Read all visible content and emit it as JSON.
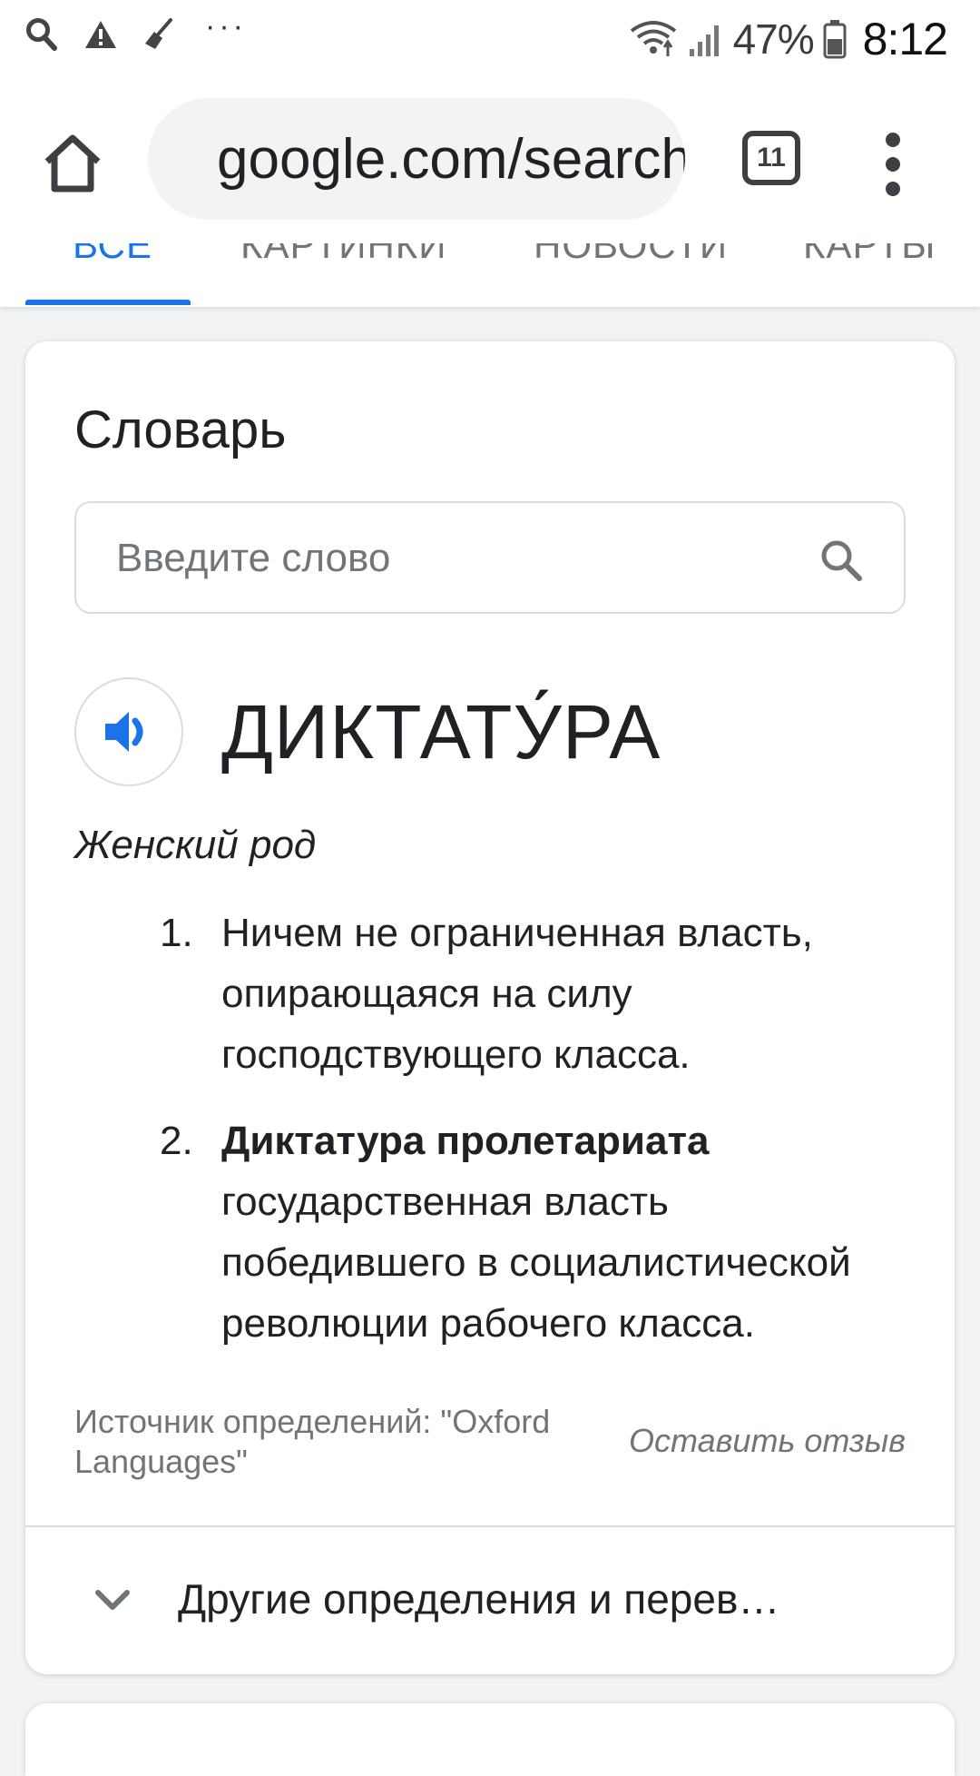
{
  "status_bar": {
    "icons": [
      "search-icon",
      "warning-icon",
      "broom-icon"
    ],
    "more": "···",
    "battery_percent": "47%",
    "time": "8:12"
  },
  "browser": {
    "url": "google.com/search",
    "tab_count": "11",
    "icons": [
      "home-icon",
      "lock-icon",
      "tabs-icon",
      "more-vert-icon"
    ]
  },
  "search_tabs": {
    "items": [
      {
        "label": "ВСЕ",
        "active": true
      },
      {
        "label": "КАРТИНКИ",
        "active": false
      },
      {
        "label": "НОВОСТИ",
        "active": false
      },
      {
        "label": "КАРТЫ",
        "active": false
      }
    ]
  },
  "dictionary": {
    "title": "Словарь",
    "input_placeholder": "Введите слово",
    "word": "ДИКТАТУ́РА",
    "part_of_speech": "Женский род",
    "definitions": [
      {
        "number": "1.",
        "bold": "",
        "text": "Ничем не ограниченная власть, опирающаяся на силу господствующего класса."
      },
      {
        "number": "2.",
        "bold": "Диктатура пролетариата",
        "text": " государственная власть победившего в социалистической революции рабочего класса."
      }
    ],
    "source": "Источник определений: \"Oxford Languages\"",
    "feedback": "Оставить отзыв",
    "more_label": "Другие определения и перев…"
  },
  "colors": {
    "accent": "#1a73e8",
    "text": "#202124",
    "secondary_text": "#70757a",
    "background": "#f1f3f4"
  }
}
